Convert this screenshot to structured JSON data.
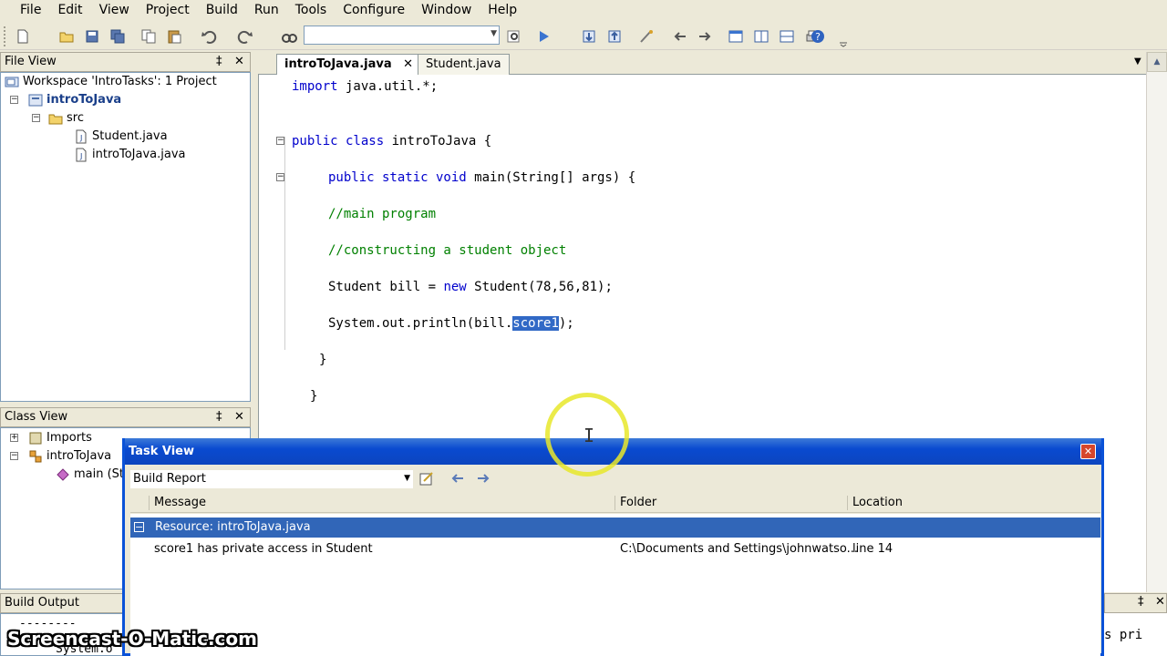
{
  "menu": [
    "File",
    "Edit",
    "View",
    "Project",
    "Build",
    "Run",
    "Tools",
    "Configure",
    "Window",
    "Help"
  ],
  "file_view": {
    "title": "File View",
    "pin": "‡",
    "close": "✕",
    "workspace": "Workspace 'IntroTasks': 1 Project",
    "project": "introToJava",
    "folder": "src",
    "files": [
      "Student.java",
      "introToJava.java"
    ]
  },
  "class_view": {
    "title": "Class View",
    "pin": "‡",
    "close": "✕",
    "items": [
      "Imports",
      "introToJava",
      "main (Stri"
    ]
  },
  "editor": {
    "tabs": [
      {
        "label": "introToJava.java",
        "close": "✕",
        "active": true
      },
      {
        "label": "Student.java",
        "active": false
      }
    ],
    "tab_menu": "▼",
    "tab_close": "✕",
    "code": {
      "l1_kw": "import",
      "l1_rest": " java.util.*;",
      "l2_kw": "public class",
      "l2_rest": " introToJava {",
      "l3_kw": "public static void",
      "l3_rest": " main(String[] args) {",
      "l4": "//main program",
      "l5": "//constructing a student object",
      "l6_a": "Student bill = ",
      "l6_kw": "new",
      "l6_b": " Student(78,56,81);",
      "l7_a": "System.out.println(bill.",
      "l7_sel": "score1",
      "l7_b": ");",
      "l8": "}",
      "l9": "}"
    }
  },
  "task_view": {
    "title": "Task View",
    "close": "✕",
    "filter": "Build Report",
    "columns": [
      "Message",
      "Folder",
      "Location"
    ],
    "group": "Resource: introToJava.java",
    "rows": [
      {
        "message": "score1 has private access in Student",
        "folder": "C:\\Documents and Settings\\johnwatso...",
        "location": "line 14"
      }
    ]
  },
  "build_output": {
    "title": "Build Output",
    "line1": "--------",
    "line2": "System.o",
    "right_text": "s pri"
  },
  "watermark": "Screencast-O-Matic.com"
}
